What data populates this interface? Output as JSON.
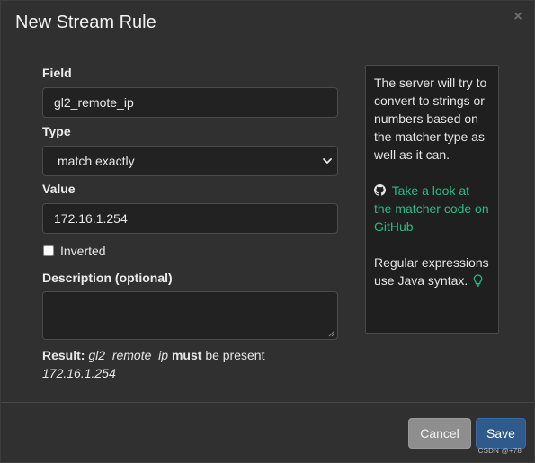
{
  "dialog": {
    "title": "New Stream Rule",
    "close_glyph": "×"
  },
  "form": {
    "field_label": "Field",
    "field_value": "gl2_remote_ip",
    "type_label": "Type",
    "type_selected": "match exactly",
    "value_label": "Value",
    "value_value": "172.16.1.254",
    "inverted_label": "Inverted",
    "inverted_checked": false,
    "description_label": "Description (optional)",
    "description_value": ""
  },
  "result": {
    "prefix": "Result:",
    "field": "gl2_remote_ip",
    "must": "must",
    "be_present": "be present",
    "value": "172.16.1.254"
  },
  "help": {
    "intro": "The server will try to convert to strings or numbers based on the matcher type as well as it can.",
    "link_icon": "github-icon",
    "link_text": "Take a look at the matcher code on GitHub",
    "regex_text": "Regular expressions use Java syntax.",
    "regex_icon": "lightbulb-icon"
  },
  "footer": {
    "cancel_label": "Cancel",
    "save_label": "Save"
  },
  "watermark": "CSDN @+78",
  "colors": {
    "accent_link": "#2fb886",
    "save_button": "#2f5a8c",
    "cancel_button": "#8e8e8e"
  }
}
